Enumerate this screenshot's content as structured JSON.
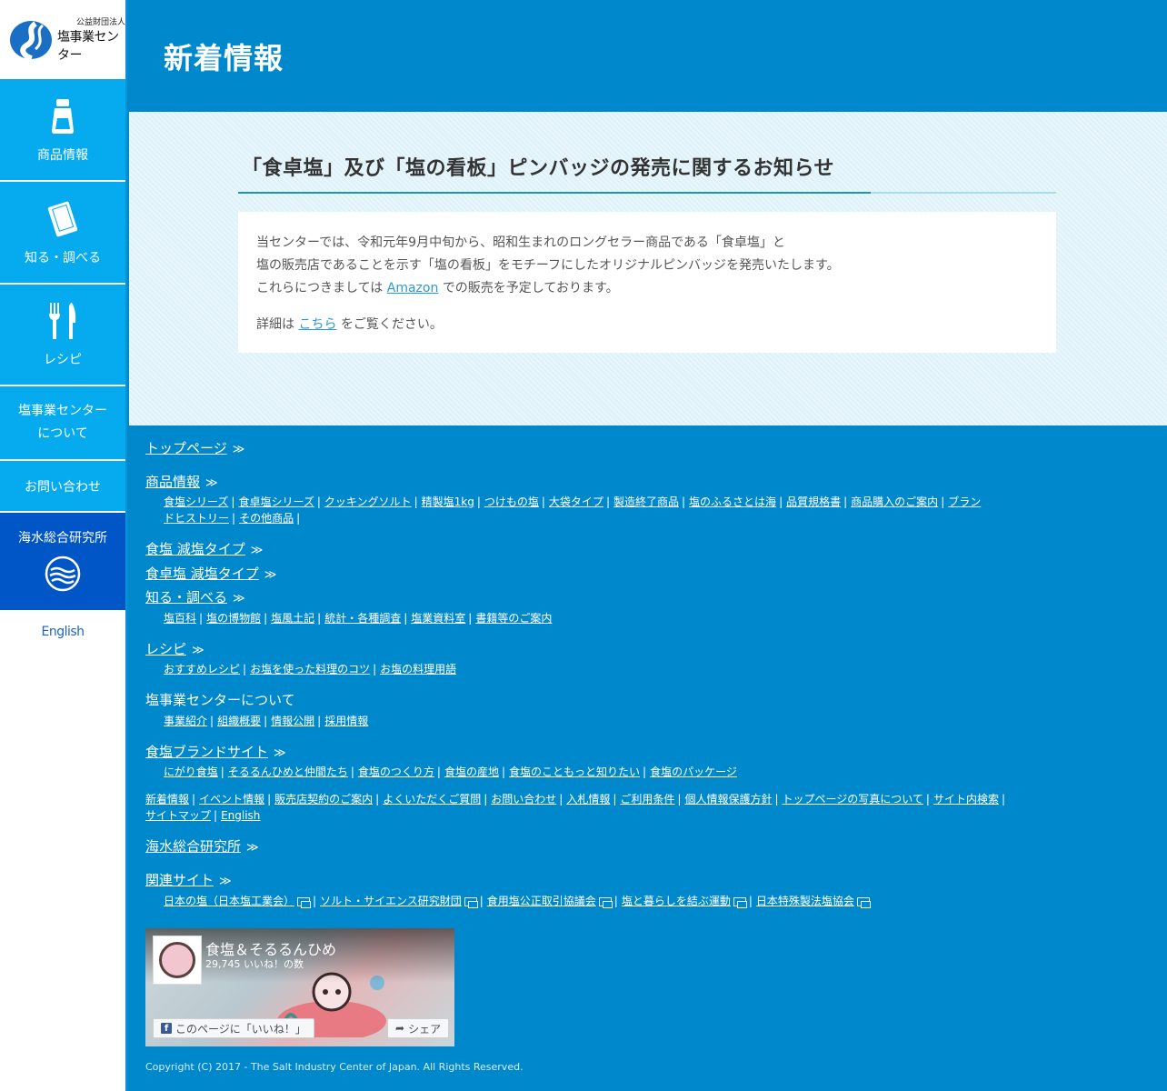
{
  "logo": {
    "org_type": "公益財団法人",
    "org_name": "塩事業センター"
  },
  "sidebar": {
    "items": [
      {
        "label": "商品情報"
      },
      {
        "label": "知る・調べる"
      },
      {
        "label": "レシピ"
      },
      {
        "label_line1": "塩事業センター",
        "label_line2": "について"
      },
      {
        "label": "お問い合わせ"
      },
      {
        "label": "海水総合研究所"
      }
    ],
    "english": "English"
  },
  "page": {
    "title": "新着情報"
  },
  "article": {
    "title": "「食卓塩」及び「塩の看板」ピンバッジの発売に関するお知らせ",
    "line1": "当センターでは、令和元年9月中旬から、昭和生まれのロングセラー商品である「食卓塩」と",
    "line2": "塩の販売店であることを示す「塩の看板」をモチーフにしたオリジナルピンバッジを発売いたします。",
    "line3_pre": "これらにつきましては",
    "line3_link": "Amazon",
    "line3_post": "での販売を予定しております。",
    "line4_pre": "詳細は",
    "line4_link": "こちら",
    "line4_post": "をご覧ください。"
  },
  "footer": {
    "top_page": "トップページ",
    "arrow": "≫",
    "products": {
      "heading": "商品情報",
      "links": [
        "食塩シリーズ",
        "食卓塩シリーズ",
        "クッキングソルト",
        "精製塩1kg",
        "つけもの塩",
        "大袋タイプ",
        "製造終了商品",
        "塩のふるさとは海",
        "品質規格書",
        "商品購入のご案内",
        "ブランドヒストリー",
        "その他商品"
      ]
    },
    "salt_reduced_1": "食塩 減塩タイプ",
    "salt_reduced_2": "食卓塩 減塩タイプ",
    "learn": {
      "heading": "知る・調べる",
      "links": [
        "塩百科",
        "塩の博物館",
        "塩風土記",
        "統計・各種調査",
        "塩業資料室",
        "書籍等のご案内"
      ]
    },
    "recipe": {
      "heading": "レシピ",
      "links": [
        "おすすめレシピ",
        "お塩を使った料理のコツ",
        "お塩の料理用語"
      ]
    },
    "about": {
      "heading": "塩事業センターについて",
      "links": [
        "事業紹介",
        "組織概要",
        "情報公開",
        "採用情報"
      ]
    },
    "brand": {
      "heading": "食塩ブランドサイト",
      "links": [
        "にがり食塩",
        "そるるんひめと仲間たち",
        "食塩のつくり方",
        "食塩の産地",
        "食塩のこともっと知りたい",
        "食塩のパッケージ"
      ]
    },
    "misc_links": [
      "新着情報",
      "イベント情報",
      "販売店契約のご案内",
      "よくいただくご質問",
      "お問い合わせ",
      "入札情報",
      "ご利用条件",
      "個人情報保護方針",
      "トップページの写真について",
      "サイト内検索",
      "サイトマップ",
      "English"
    ],
    "research": "海水総合研究所",
    "related": {
      "heading": "関連サイト",
      "links": [
        "日本の塩（日本塩工業会）",
        "ソルト・サイエンス研究財団",
        "食用塩公正取引協議会",
        "塩と暮らしを結ぶ運動",
        "日本特殊製法塩協会"
      ]
    },
    "copyright": "Copyright (C) 2017 - The Salt Industry Center of Japan. All Rights Reserved."
  },
  "facebook": {
    "page_name": "食塩＆そるるんひめ",
    "likes": "29,745 いいね！の数",
    "like_button": "このページに「いいね！」",
    "share_button": "シェア"
  },
  "colors": {
    "sidebar_blue": "#05aaef",
    "research_blue": "#0056c6",
    "footer_blue": "#0088cc",
    "article_bg": "#dff2fa",
    "link": "#2a9bd0"
  }
}
